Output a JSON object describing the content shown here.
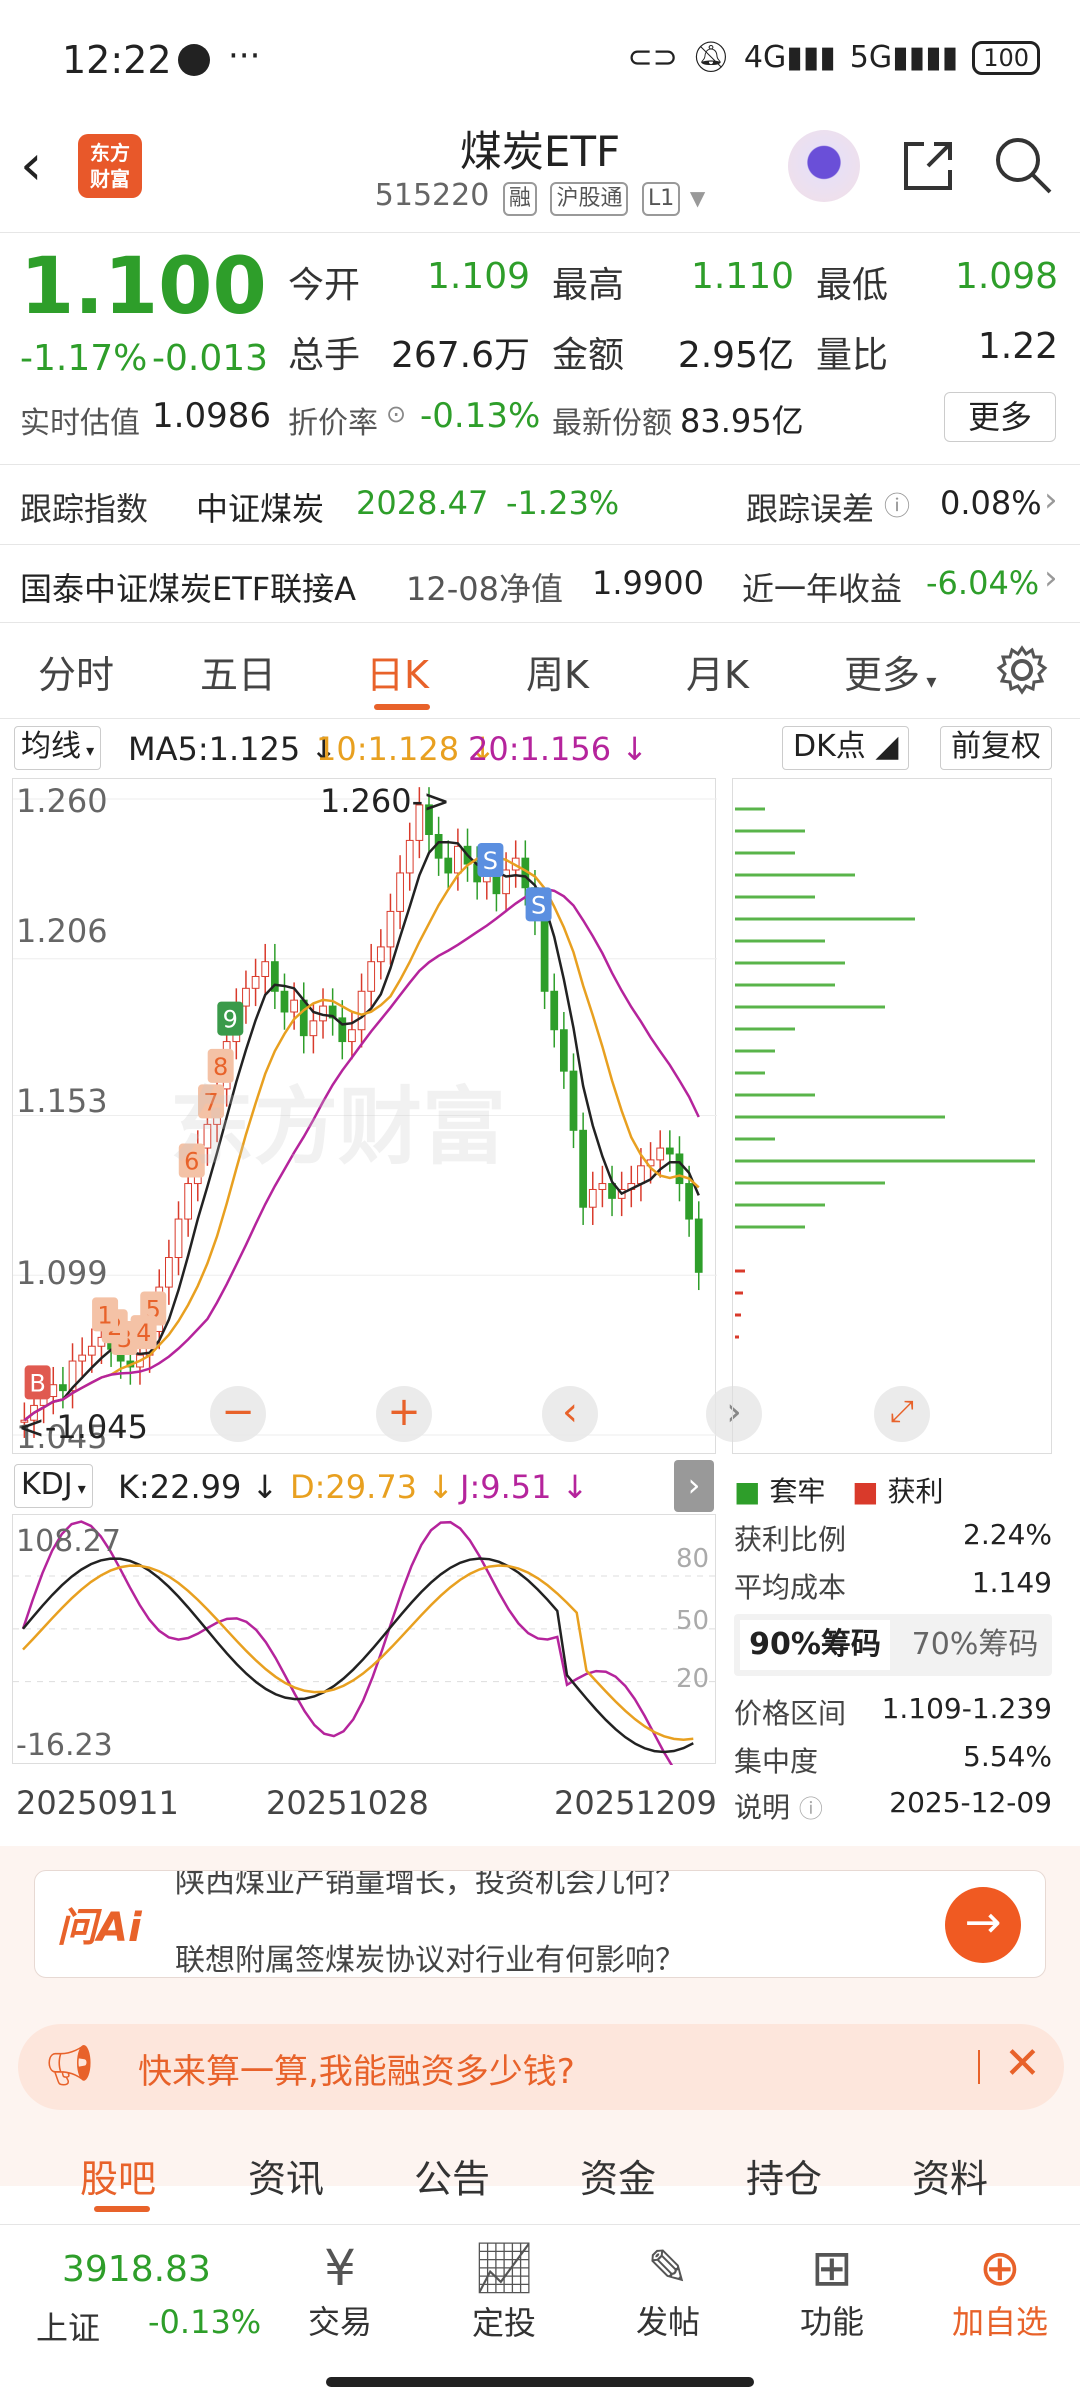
{
  "status": {
    "time": "12:22",
    "network1": "4G",
    "network2": "5G",
    "battery": "100"
  },
  "header": {
    "logo_line1": "东方",
    "logo_line2": "财富",
    "title": "煤炭ETF",
    "code": "515220",
    "tags": [
      "融",
      "沪股通",
      "L1"
    ]
  },
  "quote": {
    "price": "1.100",
    "change_pct": "-1.17%",
    "change": "-0.013",
    "fields": [
      {
        "label": "今开",
        "value": "1.109",
        "color": "green"
      },
      {
        "label": "最高",
        "value": "1.110",
        "color": "green"
      },
      {
        "label": "最低",
        "value": "1.098",
        "color": "green"
      },
      {
        "label": "总手",
        "value": "267.6万",
        "color": "dark"
      },
      {
        "label": "金额",
        "value": "2.95亿",
        "color": "dark"
      },
      {
        "label": "量比",
        "value": "1.22",
        "color": "dark"
      }
    ],
    "realtime_label": "实时估值",
    "realtime_value": "1.0986",
    "discount_label": "折价率",
    "discount_value": "-0.13%",
    "shares_label": "最新份额",
    "shares_value": "83.95亿",
    "more_button": "更多"
  },
  "tracking": {
    "label": "跟踪指数",
    "index_name": "中证煤炭",
    "index_value": "2028.47",
    "index_change": "-1.23%",
    "error_label": "跟踪误差",
    "error_value": "0.08%"
  },
  "linked": {
    "name": "国泰中证煤炭ETF联接A",
    "nav_label": "12-08净值",
    "nav_value": "1.9900",
    "return_label": "近一年收益",
    "return_value": "-6.04%"
  },
  "chart_tabs": [
    "分时",
    "五日",
    "日K",
    "周K",
    "月K",
    "更多"
  ],
  "active_tab": "日K",
  "ma": {
    "selector": "均线",
    "ma5": "MA5:1.125",
    "ma10": "10:1.128",
    "ma20": "20:1.156",
    "dk_button": "DK点",
    "adjust_button": "前复权"
  },
  "kline": {
    "y_labels": [
      "1.260",
      "1.206",
      "1.153",
      "1.099",
      "1.045"
    ],
    "high_marker": "1.260->",
    "low_marker": "<-1.045",
    "markers": [
      "8",
      "9",
      "7",
      "6",
      "5",
      "4",
      "3",
      "2",
      "1",
      "S",
      "S",
      "B"
    ],
    "watermark": "东方财富"
  },
  "chart_data": {
    "type": "candlestick",
    "ylim": [
      1.045,
      1.26
    ],
    "ma_series": [
      {
        "name": "MA5",
        "color": "#222222"
      },
      {
        "name": "MA10",
        "color": "#e8a020"
      },
      {
        "name": "MA20",
        "color": "#b5249c"
      }
    ],
    "close": [
      1.05,
      1.055,
      1.058,
      1.062,
      1.06,
      1.07,
      1.072,
      1.075,
      1.078,
      1.074,
      1.07,
      1.068,
      1.072,
      1.08,
      1.095,
      1.105,
      1.118,
      1.13,
      1.142,
      1.15,
      1.162,
      1.178,
      1.19,
      1.196,
      1.2,
      1.205,
      1.195,
      1.188,
      1.192,
      1.18,
      1.185,
      1.19,
      1.186,
      1.178,
      1.182,
      1.195,
      1.205,
      1.21,
      1.222,
      1.235,
      1.246,
      1.258,
      1.248,
      1.24,
      1.235,
      1.244,
      1.238,
      1.232,
      1.235,
      1.228,
      1.236,
      1.24,
      1.23,
      1.22,
      1.195,
      1.182,
      1.168,
      1.148,
      1.122,
      1.128,
      1.13,
      1.125,
      1.128,
      1.13,
      1.136,
      1.138,
      1.142,
      1.14,
      1.13,
      1.118,
      1.1
    ],
    "kdj": {
      "K": "22.99",
      "D": "29.73",
      "J": "9.51",
      "ylim": [
        -16.23,
        108.27
      ]
    },
    "x_labels": [
      "20250911",
      "20251028",
      "20251209"
    ]
  },
  "kdj_bar": {
    "selector": "KDJ",
    "k": "K:22.99",
    "d": "D:29.73",
    "j": "J:9.51",
    "max": "108.27",
    "min": "-16.23",
    "grid": [
      "80",
      "50",
      "20"
    ]
  },
  "chips": {
    "legend_locked": "套牢",
    "legend_profit": "获利",
    "profit_ratio_label": "获利比例",
    "profit_ratio": "2.24%",
    "avg_cost_label": "平均成本",
    "avg_cost": "1.149",
    "tab90": "90%筹码",
    "tab70": "70%筹码",
    "range_label": "价格区间",
    "range": "1.109-1.239",
    "concentration_label": "集中度",
    "concentration": "5.54%",
    "note_label": "说明",
    "note_date": "2025-12-09"
  },
  "ai": {
    "brand": "问Ai",
    "line1": "陕西煤业产销量增长，投资机会几何？",
    "line2": "联想附属签煤炭协议对行业有何影响？"
  },
  "banner": {
    "text": "快来算一算,我能融资多少钱?"
  },
  "sub_tabs": [
    "股吧",
    "资讯",
    "公告",
    "资金",
    "持仓",
    "资料"
  ],
  "active_sub_tab": "股吧",
  "bottom": {
    "index_value": "3918.83",
    "index_name": "上证",
    "index_change": "-0.13%",
    "items": [
      "交易",
      "定投",
      "发帖",
      "功能",
      "加自选"
    ]
  }
}
